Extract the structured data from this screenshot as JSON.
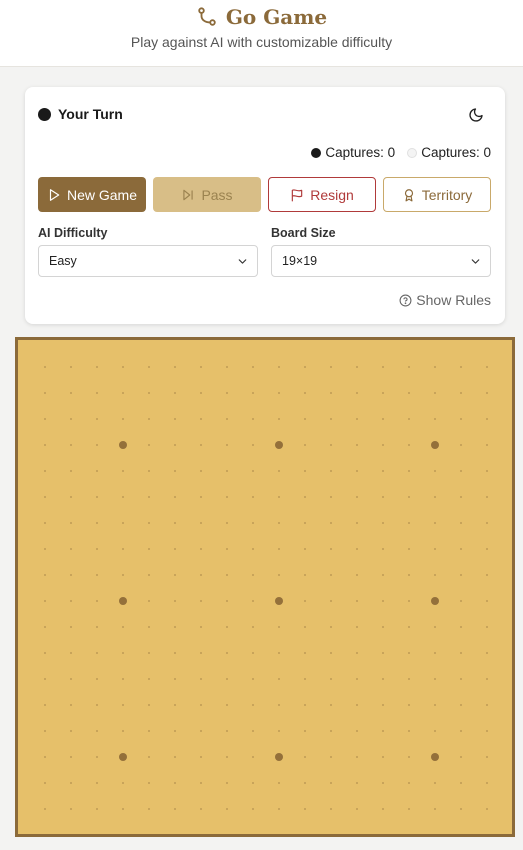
{
  "header": {
    "title": "Go Game",
    "subtitle": "Play against AI with customizable difficulty",
    "icon": "git-branch-icon"
  },
  "status": {
    "turn_label": "Your Turn",
    "turn_color": "#1a1a1a",
    "black_captures": "Captures: 0",
    "white_captures": "Captures: 0"
  },
  "toolbar": {
    "new_game": "New Game",
    "pass": "Pass",
    "resign": "Resign",
    "territory": "Territory"
  },
  "settings": {
    "difficulty_label": "AI Difficulty",
    "difficulty_value": "Easy",
    "board_size_label": "Board Size",
    "board_size_value": "19×19"
  },
  "rules_link": "Show Rules",
  "board": {
    "size": 19,
    "star_points": [
      [
        3,
        3
      ],
      [
        3,
        9
      ],
      [
        3,
        15
      ],
      [
        9,
        3
      ],
      [
        9,
        9
      ],
      [
        9,
        15
      ],
      [
        15,
        3
      ],
      [
        15,
        9
      ],
      [
        15,
        15
      ]
    ],
    "wood_color": "#e6c06a",
    "accent_color": "#8b6a3a"
  }
}
